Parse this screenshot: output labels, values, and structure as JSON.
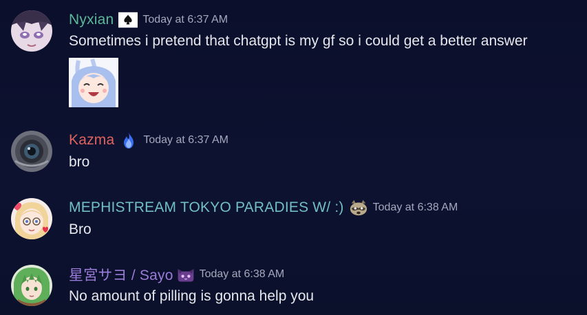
{
  "messages": [
    {
      "username": "Nyxian",
      "username_color": "#5cb89a",
      "role_icon": "ace-of-spades-card-icon",
      "timestamp": "Today at 6:37 AM",
      "content": "Sometimes i pretend that chatgpt is my gf so i could get a better answer",
      "attachment": "laughing-anime-girl-sticker"
    },
    {
      "username": "Kazma",
      "username_color": "#e0645d",
      "role_icon": "blue-flame-icon",
      "timestamp": "Today at 6:37 AM",
      "content": "bro"
    },
    {
      "username": "MEPHISTREAM TOKYO PARADIES W/ :)",
      "username_color": "#72bfc4",
      "role_icon": "raccoon-face-icon",
      "timestamp": "Today at 6:38 AM",
      "content": "Bro"
    },
    {
      "username": "星宮サヨ / Sayo",
      "username_color": "#9b7bd8",
      "role_icon": "purple-cat-icon",
      "timestamp": "Today at 6:38 AM",
      "content": "No amount of pilling is gonna help you"
    }
  ]
}
